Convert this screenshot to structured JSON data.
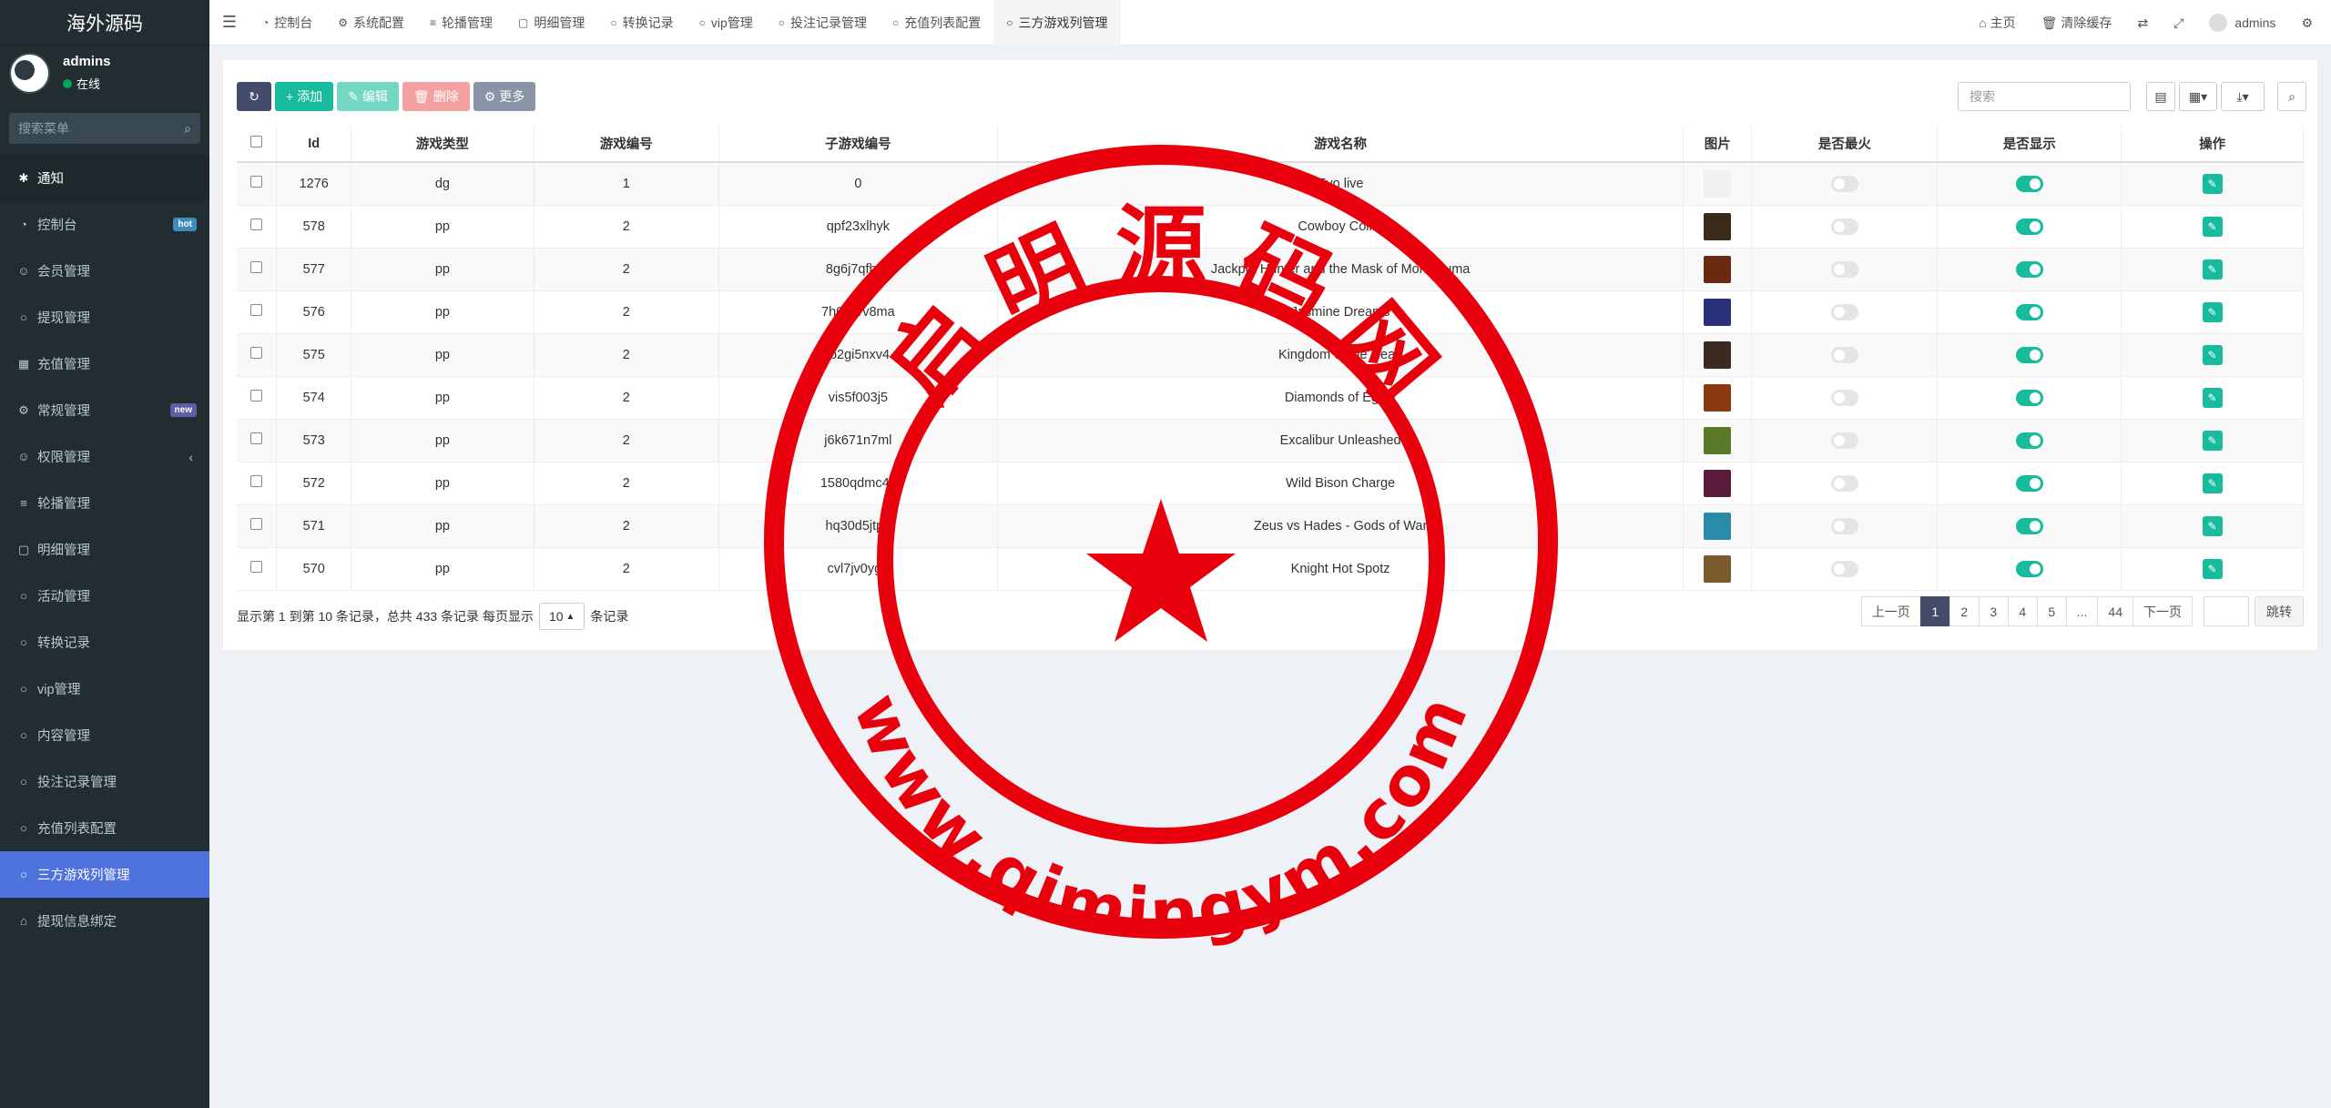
{
  "app": {
    "title": "海外源码"
  },
  "user": {
    "name": "admins",
    "status": "在线"
  },
  "sidebar": {
    "search_placeholder": "搜索菜单",
    "items": [
      {
        "label": "通知",
        "icon": "gear-icon",
        "glyph": "✱"
      },
      {
        "label": "控制台",
        "icon": "dashboard-icon",
        "glyph": "◔",
        "badge": "hot"
      },
      {
        "label": "会员管理",
        "icon": "users-icon",
        "glyph": "☺"
      },
      {
        "label": "提现管理",
        "icon": "circle-icon",
        "glyph": "○"
      },
      {
        "label": "充值管理",
        "icon": "grid-icon",
        "glyph": "▦"
      },
      {
        "label": "常规管理",
        "icon": "cogs-icon",
        "glyph": "⚙",
        "badge": "new"
      },
      {
        "label": "权限管理",
        "icon": "group-icon",
        "glyph": "☺"
      },
      {
        "label": "轮播管理",
        "icon": "list-icon",
        "glyph": "≡"
      },
      {
        "label": "明细管理",
        "icon": "calendar-icon",
        "glyph": "▢"
      },
      {
        "label": "活动管理",
        "icon": "circle-icon",
        "glyph": "○"
      },
      {
        "label": "转换记录",
        "icon": "circle-icon",
        "glyph": "○"
      },
      {
        "label": "vip管理",
        "icon": "circle-icon",
        "glyph": "○"
      },
      {
        "label": "内容管理",
        "icon": "circle-icon",
        "glyph": "○"
      },
      {
        "label": "投注记录管理",
        "icon": "circle-icon",
        "glyph": "○"
      },
      {
        "label": "充值列表配置",
        "icon": "circle-icon",
        "glyph": "○"
      },
      {
        "label": "三方游戏列管理",
        "icon": "circle-icon",
        "glyph": "○"
      },
      {
        "label": "提现信息绑定",
        "icon": "bank-icon",
        "glyph": "⌂"
      }
    ]
  },
  "topbar": {
    "tabs": [
      {
        "label": "控制台",
        "glyph": "◔"
      },
      {
        "label": "系统配置",
        "glyph": "⚙"
      },
      {
        "label": "轮播管理",
        "glyph": "≡"
      },
      {
        "label": "明细管理",
        "glyph": "▢"
      },
      {
        "label": "转换记录",
        "glyph": "○"
      },
      {
        "label": "vip管理",
        "glyph": "○"
      },
      {
        "label": "投注记录管理",
        "glyph": "○"
      },
      {
        "label": "充值列表配置",
        "glyph": "○"
      },
      {
        "label": "三方游戏列管理",
        "glyph": "○"
      }
    ],
    "home": "主页",
    "clear_cache": "清除缓存",
    "user": "admins"
  },
  "toolbar": {
    "add": "添加",
    "edit": "编辑",
    "delete": "删除",
    "more": "更多",
    "search_placeholder": "搜索"
  },
  "table": {
    "headers": [
      "Id",
      "游戏类型",
      "游戏编号",
      "子游戏编号",
      "游戏名称",
      "图片",
      "是否最火",
      "是否显示",
      "操作"
    ],
    "rows": [
      {
        "id": "1276",
        "type": "dg",
        "num": "1",
        "sub": "0",
        "name": "Evo live",
        "hot": false,
        "show": true,
        "color": "#f0f0f0"
      },
      {
        "id": "578",
        "type": "pp",
        "num": "2",
        "sub": "qpf23xlhyk",
        "name": "Cowboy Coins",
        "hot": false,
        "show": true,
        "color": "#3a2a1a"
      },
      {
        "id": "577",
        "type": "pp",
        "num": "2",
        "sub": "8g6j7qfh0x",
        "name": "Jackpot Hunter and the Mask of Montezuma",
        "hot": false,
        "show": true,
        "color": "#6b2a10"
      },
      {
        "id": "576",
        "type": "pp",
        "num": "2",
        "sub": "7h01prv8ma",
        "name": "Jasmine Dreams",
        "hot": false,
        "show": true,
        "color": "#2a2f7a"
      },
      {
        "id": "575",
        "type": "pp",
        "num": "2",
        "sub": "jb2gi5nxv4",
        "name": "Kingdom of the Dead",
        "hot": false,
        "show": true,
        "color": "#3a2a20"
      },
      {
        "id": "574",
        "type": "pp",
        "num": "2",
        "sub": "vis5f003j5",
        "name": "Diamonds of Egypt",
        "hot": false,
        "show": true,
        "color": "#8a3a10"
      },
      {
        "id": "573",
        "type": "pp",
        "num": "2",
        "sub": "j6k671n7ml",
        "name": "Excalibur Unleashed",
        "hot": false,
        "show": true,
        "color": "#5a7a2a"
      },
      {
        "id": "572",
        "type": "pp",
        "num": "2",
        "sub": "1580qdmc4k",
        "name": "Wild Bison Charge",
        "hot": false,
        "show": true,
        "color": "#5a1a3a"
      },
      {
        "id": "571",
        "type": "pp",
        "num": "2",
        "sub": "hq30d5jtp6",
        "name": "Zeus vs Hades - Gods of War",
        "hot": false,
        "show": true,
        "color": "#2a8aaa"
      },
      {
        "id": "570",
        "type": "pp",
        "num": "2",
        "sub": "cvl7jv0yg7",
        "name": "Knight Hot Spotz",
        "hot": false,
        "show": true,
        "color": "#7a5a2a"
      }
    ]
  },
  "pagination": {
    "summary_prefix": "显示第 1 到第 10 条记录，总共 433 条记录 每页显示",
    "page_size": "10",
    "summary_suffix": "条记录",
    "prev": "上一页",
    "pages": [
      "1",
      "2",
      "3",
      "4",
      "5",
      "...",
      "44"
    ],
    "next": "下一页",
    "go": "跳转"
  },
  "watermark": {
    "chars": [
      "启",
      "明",
      "源",
      "码",
      "网"
    ],
    "url": "www.qimingym.com",
    "color": "#e8000c"
  }
}
